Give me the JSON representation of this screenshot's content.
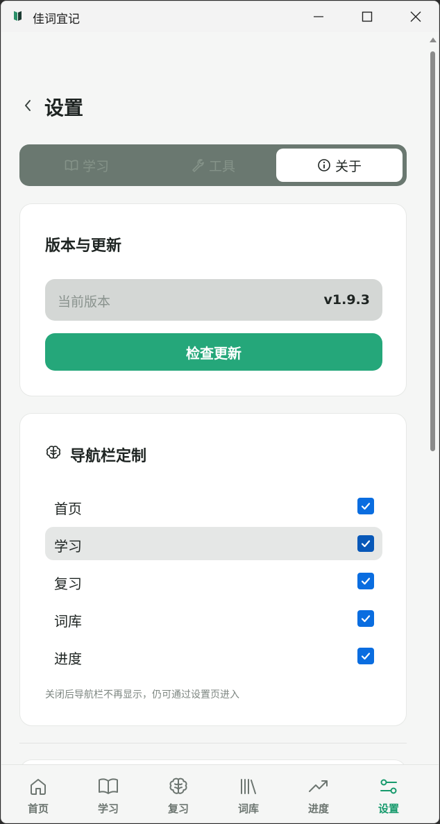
{
  "window": {
    "title": "佳词宜记"
  },
  "header": {
    "title": "设置"
  },
  "tabs": [
    {
      "label": "学习",
      "icon": "book-icon",
      "active": false
    },
    {
      "label": "工具",
      "icon": "wrench-icon",
      "active": false
    },
    {
      "label": "关于",
      "icon": "info-icon",
      "active": true
    }
  ],
  "version_card": {
    "title": "版本与更新",
    "current_label": "当前版本",
    "current_value": "v1.9.3",
    "check_button": "检查更新"
  },
  "nav_custom_card": {
    "title": "导航栏定制",
    "items": [
      {
        "label": "首页",
        "checked": true
      },
      {
        "label": "学习",
        "checked": true
      },
      {
        "label": "复习",
        "checked": true
      },
      {
        "label": "词库",
        "checked": true
      },
      {
        "label": "进度",
        "checked": true
      }
    ],
    "hint": "关闭后导航栏不再显示，仍可通过设置页进入"
  },
  "bottom_nav": [
    {
      "label": "首页",
      "icon": "home-icon"
    },
    {
      "label": "学习",
      "icon": "book-icon"
    },
    {
      "label": "复习",
      "icon": "brain-icon"
    },
    {
      "label": "词库",
      "icon": "library-icon"
    },
    {
      "label": "进度",
      "icon": "trend-icon"
    },
    {
      "label": "设置",
      "icon": "sliders-icon",
      "active": true
    }
  ],
  "colors": {
    "accent": "#25a77a",
    "active_nav": "#169a6c",
    "checkbox": "#0a6de0",
    "segment_bg": "#6a7870"
  }
}
